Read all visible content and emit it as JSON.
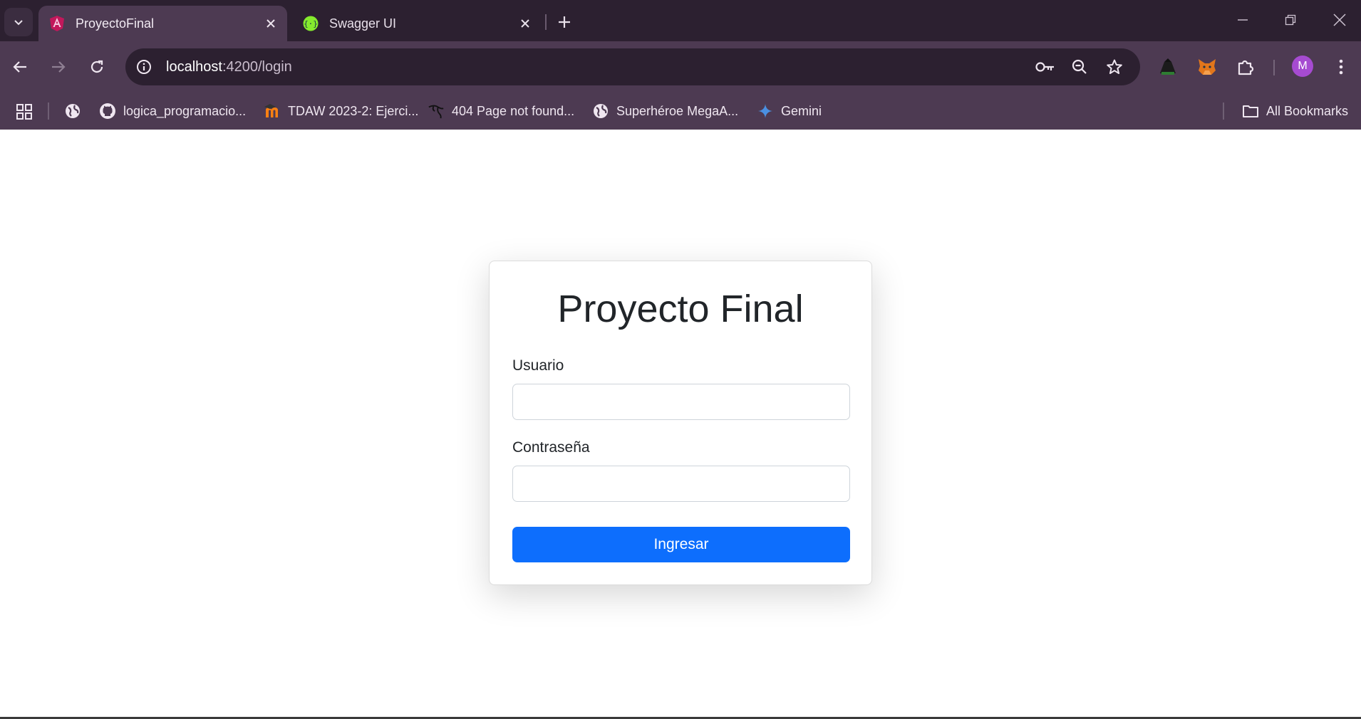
{
  "browser": {
    "tabs": [
      {
        "title": "ProyectoFinal",
        "favicon": "angular-icon",
        "active": true
      },
      {
        "title": "Swagger UI",
        "favicon": "swagger-icon",
        "active": false
      }
    ],
    "address": {
      "host": "localhost",
      "path": ":4200/login"
    },
    "profile_initial": "M",
    "bookmarks": [
      {
        "label": "logica_programacio...",
        "icon": "github-icon"
      },
      {
        "label": "TDAW 2023-2: Ejerci...",
        "icon": "moodle-icon"
      },
      {
        "label": "404 Page not found...",
        "icon": "kali-dragon-icon"
      },
      {
        "label": "Superhéroe MegaA...",
        "icon": "globe-icon"
      },
      {
        "label": "Gemini",
        "icon": "gemini-icon"
      }
    ],
    "all_bookmarks_label": "All Bookmarks"
  },
  "login": {
    "title": "Proyecto Final",
    "username_label": "Usuario",
    "username_value": "",
    "password_label": "Contraseña",
    "password_value": "",
    "submit_label": "Ingresar"
  },
  "colors": {
    "primary": "#0d6efd",
    "chrome_dark": "#2c2030",
    "chrome_light": "#4d3a52"
  }
}
